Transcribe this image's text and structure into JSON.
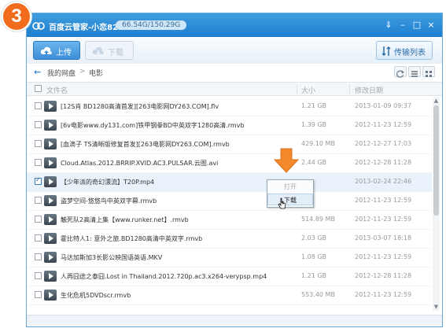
{
  "step_number": "3",
  "window": {
    "title": "百度云管家-小恋828",
    "quota": "66.54G/150.29G",
    "controls": {
      "menu": "⇓",
      "minimize": "–",
      "maximize": "□",
      "close": "×"
    }
  },
  "toolbar": {
    "upload_label": "上传",
    "download_label": "下载",
    "transfer_label": "传输列表"
  },
  "nav": {
    "breadcrumb": [
      "我的网盘",
      "电影"
    ],
    "separator": ">"
  },
  "columns": {
    "name": "文件名",
    "size": "大小",
    "date": "修改日期"
  },
  "files": [
    {
      "name": "[12S肖 BD1280高清首发][263电影网DY263.COM].flv",
      "size": "1.21 GB",
      "date": "2013-01-09 09:37",
      "checked": false
    },
    {
      "name": "[6v电影www.dy131.com]铁甲钢拳BD中英双字1280高清.rmvb",
      "size": "1.39 GB",
      "date": "2012-11-23 12:59",
      "checked": false
    },
    {
      "name": "[血滴子 TS清晰版修复首发][263电影网DY263.COM].rmvb",
      "size": "429.10 MB",
      "date": "2012-12-27 17:03",
      "checked": false
    },
    {
      "name": "Cloud.Atlas.2012.BRRIP.XVID.AC3.PULSAR.云图.avi",
      "size": "2.44 GB",
      "date": "2012-12-28 11:28",
      "checked": false
    },
    {
      "name": "【少年派的奇幻漂流】T20P.mp4",
      "size": "",
      "date": "2013-02-24 22:46",
      "checked": true
    },
    {
      "name": "盗梦空间-悠悠鸟中英双字幕.rmvb",
      "size": "",
      "date": "2012-11-23 12:59",
      "checked": false
    },
    {
      "name": "触死队2高清上集【www.runker.net】.rmvb",
      "size": "514.89 MB",
      "date": "2012-11-23 12:59",
      "checked": false
    },
    {
      "name": "霍比特人1: 意外之旅.BD1280高清中英双字.rmvb",
      "size": "2.03 GB",
      "date": "2013-03-07 18:18",
      "checked": false
    },
    {
      "name": "马达加斯加3长影公映国语英语.MKV",
      "size": "1.08 GB",
      "date": "2012-11-23 12:59",
      "checked": false
    },
    {
      "name": "人再囧途之泰囧.Lost in Thailand.2012.720p.ac3.x264-verypsp.mp4",
      "size": "1.21 GB",
      "date": "2012-12-28 11:28",
      "checked": false
    },
    {
      "name": "生化危机5DVDscr.rmvb",
      "size": "553.40 MB",
      "date": "2012-11-23 12:59",
      "checked": false
    }
  ],
  "context_menu": {
    "items": [
      {
        "label": "打开",
        "disabled": true
      },
      {
        "label": "下载",
        "disabled": false
      }
    ]
  },
  "colors": {
    "titlebar": "#2b8ad6",
    "accent": "#3b8fd8",
    "badge": "#f26c1d",
    "hint_arrow": "#f28a2b"
  }
}
